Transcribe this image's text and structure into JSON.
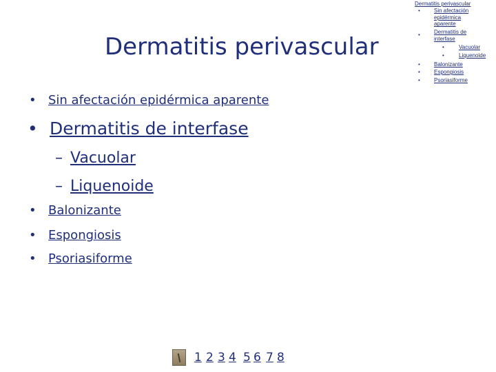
{
  "slide": {
    "title": "Dermatitis perivascular",
    "bullets": [
      {
        "text": "Sin afectación epidérmica aparente"
      },
      {
        "text": "Dermatitis de interfase"
      },
      {
        "text": "Vacuolar"
      },
      {
        "text": "Liquenoide"
      },
      {
        "text": "Balonizante"
      },
      {
        "text": "Espongiosis"
      },
      {
        "text": "Psoriasiforme"
      }
    ],
    "bullet_char": "•",
    "sub_bullet_char": "–"
  },
  "outline": {
    "title": "Dermatitis perivascular",
    "items": [
      {
        "lines": [
          "Sin afectación",
          "epidérmica",
          "aparente"
        ]
      },
      {
        "lines": [
          "Dermatitis de",
          "interfase"
        ]
      },
      {
        "text": "Vacuolar"
      },
      {
        "text": "Liquenoide"
      },
      {
        "text": "Balonizante"
      },
      {
        "text": "Espongiosis"
      },
      {
        "text": "Psoriasiforme"
      }
    ],
    "dot_char": "•"
  },
  "nav": {
    "pages": [
      "1",
      "2",
      "3",
      "4",
      "5",
      "6",
      "7",
      "8"
    ]
  }
}
